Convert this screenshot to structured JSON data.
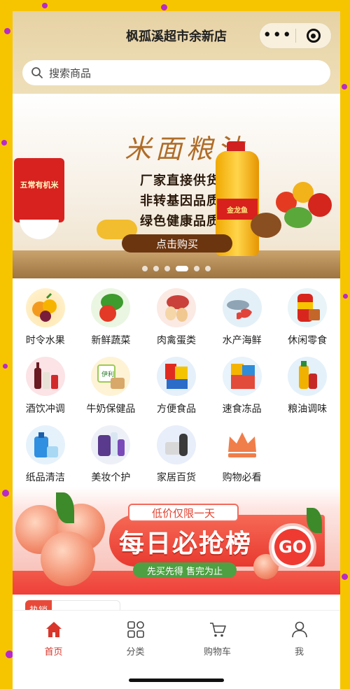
{
  "header": {
    "title": "枫孤溪超市余新店",
    "more_glyph": "•••"
  },
  "search": {
    "placeholder": "搜索商品"
  },
  "banner": {
    "headline": "米面粮油",
    "lines": [
      "厂家直接供货",
      "非转基因品质",
      "绿色健康品质"
    ],
    "cta": "点击购买",
    "rice_bag_label": "五常有机米",
    "oil_label": "金龙鱼",
    "slide_count": 6,
    "active_slide": 3
  },
  "categories": [
    [
      {
        "label": "时令水果",
        "icon": "fruit-icon"
      },
      {
        "label": "新鲜蔬菜",
        "icon": "vegetable-icon"
      },
      {
        "label": "肉禽蛋类",
        "icon": "meat-egg-icon"
      },
      {
        "label": "水产海鲜",
        "icon": "seafood-icon"
      },
      {
        "label": "休闲零食",
        "icon": "snack-icon"
      }
    ],
    [
      {
        "label": "酒饮冲调",
        "icon": "drinks-icon"
      },
      {
        "label": "牛奶保健品",
        "icon": "milk-icon"
      },
      {
        "label": "方便食品",
        "icon": "instant-food-icon"
      },
      {
        "label": "速食冻品",
        "icon": "frozen-food-icon"
      },
      {
        "label": "粮油调味",
        "icon": "grain-oil-icon"
      }
    ],
    [
      {
        "label": "纸品清洁",
        "icon": "cleaning-icon"
      },
      {
        "label": "美妆个护",
        "icon": "beauty-icon"
      },
      {
        "label": "家居百货",
        "icon": "household-icon"
      },
      {
        "label": "购物必看",
        "icon": "crown-icon"
      }
    ]
  ],
  "promo": {
    "tag": "低价仅限一天",
    "title": "每日必抢榜",
    "subtitle": "先买先得 售完为止",
    "go": "GO"
  },
  "hot_sale": {
    "badge": "热销"
  },
  "tabbar": [
    {
      "label": "首页",
      "icon": "home-icon",
      "active": true
    },
    {
      "label": "分类",
      "icon": "category-icon",
      "active": false
    },
    {
      "label": "购物车",
      "icon": "cart-icon",
      "active": false
    },
    {
      "label": "我",
      "icon": "user-icon",
      "active": false
    }
  ],
  "colors": {
    "accent": "#d9352a",
    "frame": "#f7c400",
    "header": "#e6d2a4"
  }
}
